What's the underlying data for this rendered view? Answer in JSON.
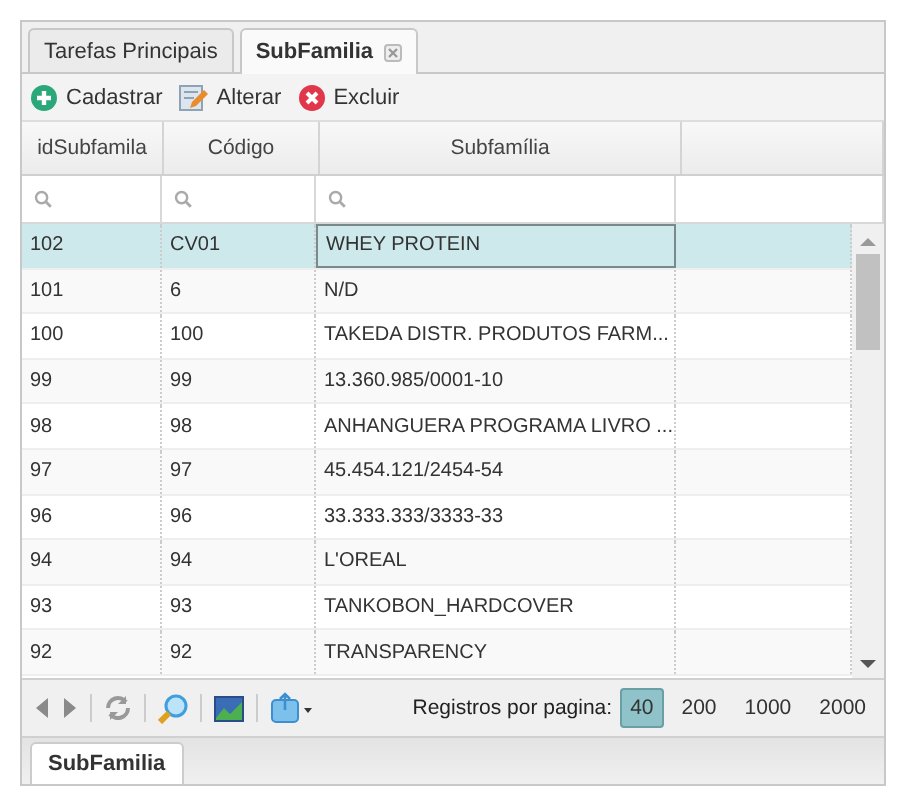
{
  "tabs": [
    {
      "label": "Tarefas Principais",
      "selected": false,
      "closable": false
    },
    {
      "label": "SubFamilia",
      "selected": true,
      "closable": true
    }
  ],
  "toolbar": [
    {
      "label": "Cadastrar",
      "kind": "add"
    },
    {
      "label": "Alterar",
      "kind": "edit"
    },
    {
      "label": "Excluir",
      "kind": "delete"
    }
  ],
  "table": {
    "columns": [
      "idSubfamila",
      "Código",
      "Subfamília"
    ],
    "rows": [
      {
        "cells": [
          "102",
          "CV01",
          "WHEY PROTEIN"
        ],
        "selected": true
      },
      {
        "cells": [
          "101",
          "6",
          "N/D"
        ],
        "selected": false
      },
      {
        "cells": [
          "100",
          "100",
          "TAKEDA DISTR. PRODUTOS FARM..."
        ],
        "selected": false
      },
      {
        "cells": [
          "99",
          "99",
          "13.360.985/0001-10"
        ],
        "selected": false
      },
      {
        "cells": [
          "98",
          "98",
          "ANHANGUERA PROGRAMA LIVRO ..."
        ],
        "selected": false
      },
      {
        "cells": [
          "97",
          "97",
          "45.454.121/2454-54"
        ],
        "selected": false
      },
      {
        "cells": [
          "96",
          "96",
          "33.333.333/3333-33"
        ],
        "selected": false
      },
      {
        "cells": [
          "94",
          "94",
          "L'OREAL"
        ],
        "selected": false
      },
      {
        "cells": [
          "93",
          "93",
          "TANKOBON_HARDCOVER"
        ],
        "selected": false
      },
      {
        "cells": [
          "92",
          "92",
          "TRANSPARENCY"
        ],
        "selected": false
      }
    ]
  },
  "pager": {
    "label": "Registros por pagina:",
    "sizes": [
      {
        "label": "40",
        "selected": true
      },
      {
        "label": "200",
        "selected": false
      },
      {
        "label": "1000",
        "selected": false
      },
      {
        "label": "2000",
        "selected": false
      }
    ]
  },
  "bottom_tabs": [
    {
      "label": "SubFamilia",
      "selected": true
    }
  ]
}
